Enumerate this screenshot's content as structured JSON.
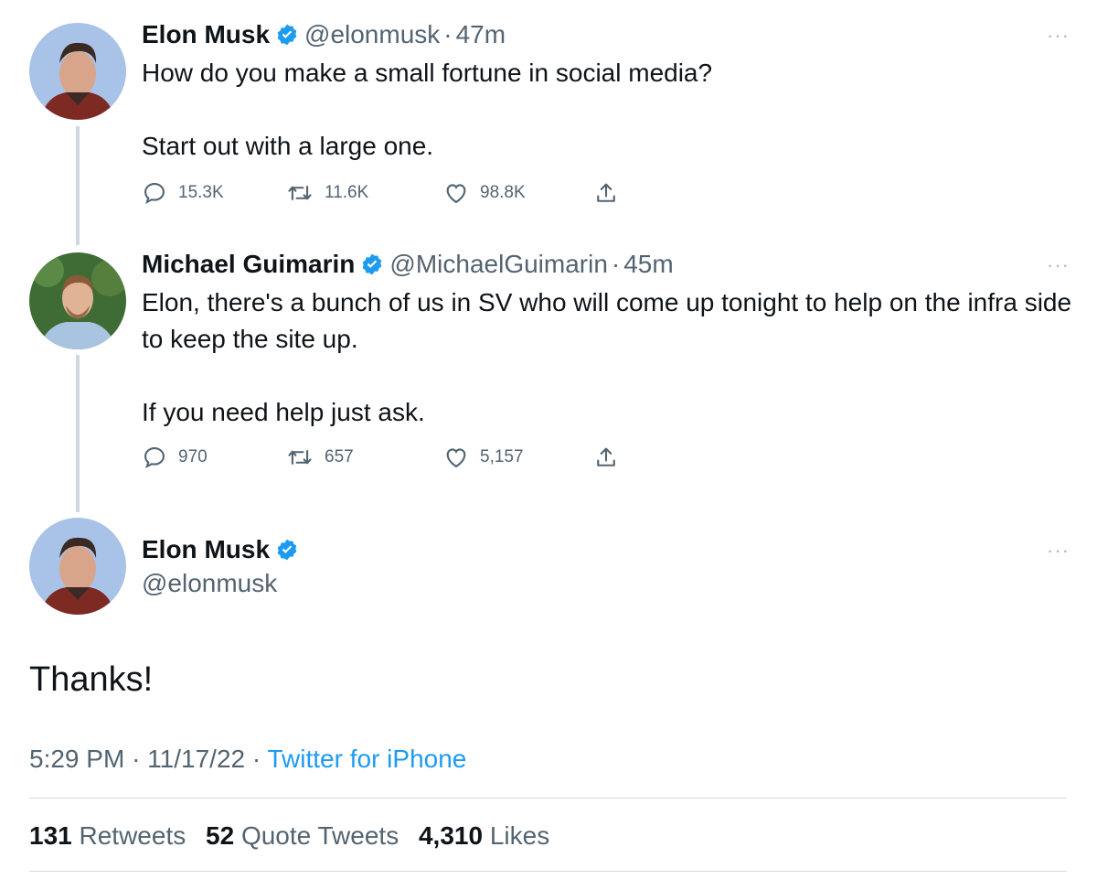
{
  "colors": {
    "text": "#0f1419",
    "secondary": "#536471",
    "link": "#1d9bf0",
    "verified": "#1d9bf0",
    "thread_line": "#cfd9de"
  },
  "tweets": [
    {
      "name": "Elon Musk",
      "handle": "@elonmusk",
      "separator": "·",
      "time": "47m",
      "paragraphs": [
        "How do you make a small fortune in social media?",
        "Start out with a large one."
      ],
      "replies": "15.3K",
      "retweets": "11.6K",
      "likes": "98.8K",
      "more": "···"
    },
    {
      "name": "Michael Guimarin",
      "handle": "@MichaelGuimarin",
      "separator": "·",
      "time": "45m",
      "paragraphs": [
        "Elon, there's a bunch of us in SV who will come up tonight to help on the infra side to keep the site up.",
        "If you need help just ask."
      ],
      "replies": "970",
      "retweets": "657",
      "likes": "5,157",
      "more": "···"
    }
  ],
  "main_tweet": {
    "name": "Elon Musk",
    "handle": "@elonmusk",
    "text": "Thanks!",
    "time": "5:29 PM",
    "sep1": "·",
    "date": "11/17/22",
    "sep2": "·",
    "source": "Twitter for iPhone",
    "more": "···",
    "stats": {
      "retweets_count": "131",
      "retweets_label": "Retweets",
      "quotes_count": "52",
      "quotes_label": "Quote Tweets",
      "likes_count": "4,310",
      "likes_label": "Likes"
    }
  },
  "icons": {
    "reply": "reply-icon",
    "retweet": "retweet-icon",
    "like": "like-icon",
    "share": "share-icon",
    "verified": "verified-badge-icon",
    "more": "more-icon"
  }
}
